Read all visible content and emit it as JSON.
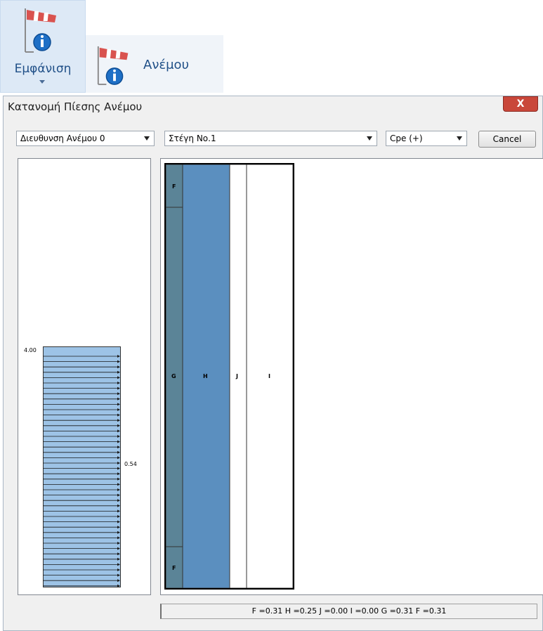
{
  "ribbon": {
    "large_button_label": "Εμφάνιση",
    "small_button_label": "Ανέμου",
    "icon": "windsock-info-icon"
  },
  "dialog": {
    "title": "Κατανομή Πίεσης Ανέμου",
    "close_label": "X",
    "wind_direction": "Διευθυνση Ανέμου 0",
    "roof_select": "Στέγη Νο.1",
    "cpe_select": "Cpe (+)",
    "cancel_label": "Cancel",
    "profile": {
      "top_value": "4.00",
      "mid_value": "0.54",
      "fill_color": "#9dc3e6"
    },
    "roof_zones": [
      {
        "name": "F"
      },
      {
        "name": "G"
      },
      {
        "name": "F"
      },
      {
        "name": "H"
      },
      {
        "name": "J"
      },
      {
        "name": "I"
      }
    ],
    "zone_colors": {
      "F": "#5b8497",
      "G": "#5b8497",
      "H": "#5b8fbf",
      "J": "#ffffff",
      "I": "#ffffff"
    },
    "status_text": "F =0.31 H =0.25 J =0.00 I =0.00 G =0.31 F =0.31"
  }
}
